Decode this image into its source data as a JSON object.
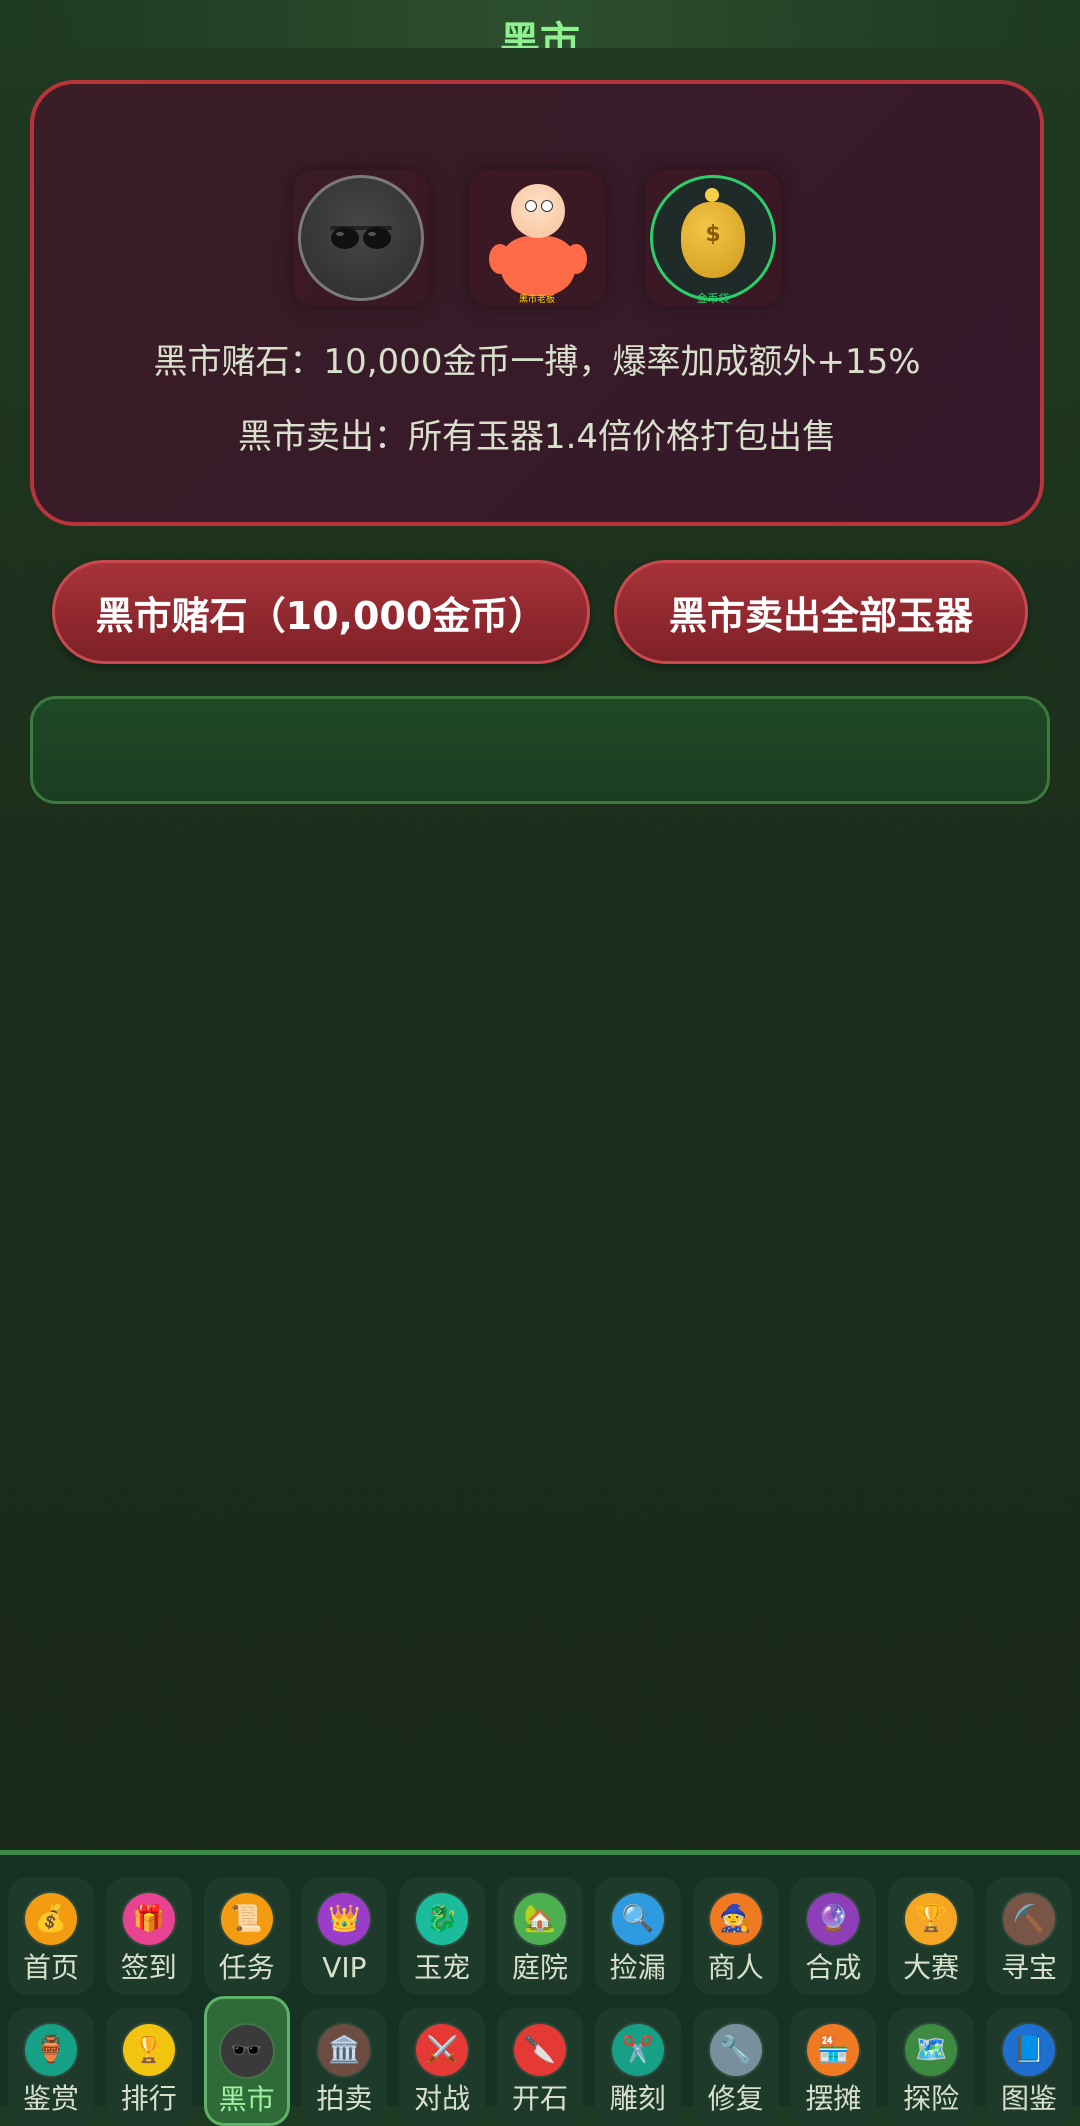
{
  "header": {
    "title": "黑市"
  },
  "card": {
    "line1": "黑市赌石：10,000金币一搏，爆率加成额外+15%",
    "line2": "黑市卖出：所有玉器1.4倍价格打包出售",
    "bag_caption": "金币袋",
    "boss_caption": "黑市老板"
  },
  "actions": {
    "gamble_label": "黑市赌石（10,000金币）",
    "sell_label": "黑市卖出全部玉器"
  },
  "nav_row1": [
    {
      "label": "首页",
      "icon": "money-bag-icon",
      "glyph": "💰",
      "color": "#f39c12"
    },
    {
      "label": "签到",
      "icon": "gift-icon",
      "glyph": "🎁",
      "color": "#e84393"
    },
    {
      "label": "任务",
      "icon": "scroll-icon",
      "glyph": "📜",
      "color": "#f39c12"
    },
    {
      "label": "VIP",
      "icon": "crown-icon",
      "glyph": "👑",
      "color": "#9b3dc8"
    },
    {
      "label": "玉宠",
      "icon": "dragon-icon",
      "glyph": "🐉",
      "color": "#1abc9c"
    },
    {
      "label": "庭院",
      "icon": "house-icon",
      "glyph": "🏡",
      "color": "#4caf50"
    },
    {
      "label": "捡漏",
      "icon": "magnifier-icon",
      "glyph": "🔍",
      "color": "#2e9be0"
    },
    {
      "label": "商人",
      "icon": "merchant-icon",
      "glyph": "🧙",
      "color": "#f07a22"
    },
    {
      "label": "合成",
      "icon": "crystal-ball-icon",
      "glyph": "🔮",
      "color": "#8e3fb8"
    },
    {
      "label": "大赛",
      "icon": "trophy-icon",
      "glyph": "🏆",
      "color": "#f5a623"
    },
    {
      "label": "寻宝",
      "icon": "pickaxe-icon",
      "glyph": "⛏️",
      "color": "#795548"
    }
  ],
  "nav_row2": [
    {
      "label": "鉴赏",
      "icon": "vase-icon",
      "glyph": "🏺",
      "color": "#16a085"
    },
    {
      "label": "排行",
      "icon": "trophy-icon",
      "glyph": "🏆",
      "color": "#f1c40f"
    },
    {
      "label": "黑市",
      "icon": "sunglasses-icon",
      "glyph": "🕶️",
      "color": "#3a3a3a",
      "active": true
    },
    {
      "label": "拍卖",
      "icon": "auction-house-icon",
      "glyph": "🏛️",
      "color": "#6d4c41"
    },
    {
      "label": "对战",
      "icon": "crossed-swords-icon",
      "glyph": "⚔️",
      "color": "#e53935"
    },
    {
      "label": "开石",
      "icon": "knife-icon",
      "glyph": "🔪",
      "color": "#e53935"
    },
    {
      "label": "雕刻",
      "icon": "scissors-icon",
      "glyph": "✂️",
      "color": "#16a085"
    },
    {
      "label": "修复",
      "icon": "wrench-icon",
      "glyph": "🔧",
      "color": "#78909c"
    },
    {
      "label": "摆摊",
      "icon": "shop-icon",
      "glyph": "🏪",
      "color": "#f07a22"
    },
    {
      "label": "探险",
      "icon": "map-icon",
      "glyph": "🗺️",
      "color": "#3d8b40"
    },
    {
      "label": "图鉴",
      "icon": "book-icon",
      "glyph": "📘",
      "color": "#1e6fd0"
    }
  ]
}
